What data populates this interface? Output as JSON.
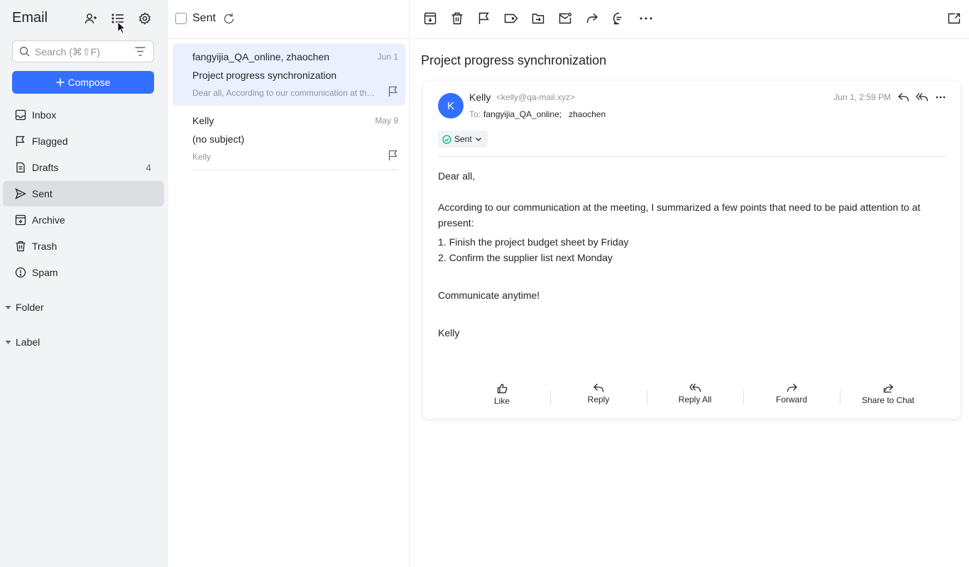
{
  "sidebar": {
    "brand": "Email",
    "search_placeholder": "Search (⌘⇧F)",
    "compose_label": "Compose",
    "items": [
      {
        "label": "Inbox",
        "count": ""
      },
      {
        "label": "Flagged",
        "count": ""
      },
      {
        "label": "Drafts",
        "count": "4"
      },
      {
        "label": "Sent",
        "count": ""
      },
      {
        "label": "Archive",
        "count": ""
      },
      {
        "label": "Trash",
        "count": ""
      },
      {
        "label": "Spam",
        "count": ""
      }
    ],
    "sections": {
      "folder": "Folder",
      "label": "Label"
    }
  },
  "list": {
    "title": "Sent",
    "messages": [
      {
        "from": "fangyijia_QA_online, zhaochen",
        "date": "Jun 1",
        "subject": "Project progress synchronization",
        "preview": "Dear all, According to our communication at the meeting, I summarized"
      },
      {
        "from": "Kelly",
        "date": "May 9",
        "subject": "(no subject)",
        "preview": "Kelly"
      }
    ]
  },
  "reader": {
    "subject": "Project progress synchronization",
    "avatar_initial": "K",
    "sender_name": "Kelly",
    "sender_email": "<kelly@qa-mail.xyz>",
    "to_label": "To:",
    "recipients": [
      "fangyijia_QA_online;",
      "zhaochen"
    ],
    "date": "Jun 1, 2:59 PM",
    "status": "Sent",
    "body": {
      "greeting": "Dear all,",
      "intro": "According to our communication at the meeting, I summarized a few points that need to be paid attention to at present:",
      "point1": "1. Finish the project budget sheet by Friday",
      "point2": "2. Confirm the supplier list next Monday",
      "closing": "Communicate anytime!",
      "signature": "Kelly"
    },
    "actions": {
      "like": "Like",
      "reply": "Reply",
      "reply_all": "Reply All",
      "forward": "Forward",
      "share": "Share to Chat"
    }
  },
  "colors": {
    "accent": "#3370ff",
    "sidebar_bg": "#f2f3f5",
    "selected_row": "#eaf0fd",
    "status_ok": "#00b386"
  }
}
